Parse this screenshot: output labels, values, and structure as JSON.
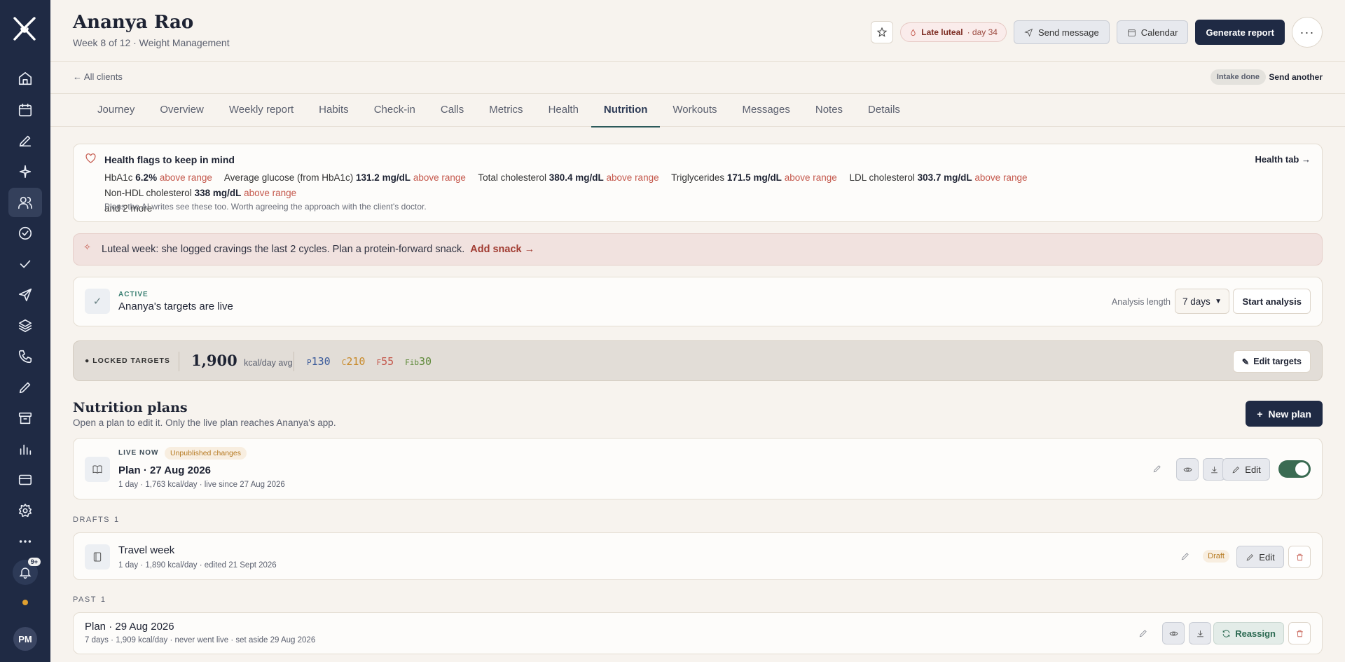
{
  "client": {
    "name": "Ananya Rao",
    "subtitle": "Week 8 of 12 · Weight Management"
  },
  "header": {
    "phase_label": "Late luteal",
    "phase_day": "· day 34",
    "send_message": "Send message",
    "calendar": "Calendar",
    "generate_report": "Generate report",
    "more": "···"
  },
  "breadcrumb": {
    "back": "All clients",
    "intake": "Intake done",
    "send_another": "Send another"
  },
  "tabs": [
    "Journey",
    "Overview",
    "Weekly report",
    "Habits",
    "Check-in",
    "Calls",
    "Metrics",
    "Health",
    "Nutrition",
    "Workouts",
    "Messages",
    "Notes",
    "Details"
  ],
  "active_tab": "Nutrition",
  "health_flags": {
    "title": "Health flags to keep in mind",
    "link": "Health tab →",
    "above_label": "above range",
    "items": [
      {
        "name": "HbA1c",
        "value": "6.2%"
      },
      {
        "name": "Average glucose (from HbA1c)",
        "value": "131.2 mg/dL"
      },
      {
        "name": "Total cholesterol",
        "value": "380.4 mg/dL"
      },
      {
        "name": "Triglycerides",
        "value": "171.5 mg/dL"
      },
      {
        "name": "LDL cholesterol",
        "value": "303.7 mg/dL"
      },
      {
        "name": "Non-HDL cholesterol",
        "value": "338 mg/dL"
      }
    ],
    "more": "and 2 more",
    "note": "Plans the AI writes see these too. Worth agreeing the approach with the client's doctor."
  },
  "luteal_tip": {
    "text": "Luteal week: she logged cravings the last 2 cycles. Plan a protein-forward snack.",
    "action": "Add snack →"
  },
  "active": {
    "label": "ACTIVE",
    "title": "Ananya's targets are live",
    "analysis_label": "Analysis length",
    "analysis_value": "7 days",
    "start": "Start analysis"
  },
  "locked": {
    "label": "LOCKED TARGETS",
    "kcal": "1,900",
    "kcal_unit": "kcal/day avg",
    "macros": [
      {
        "key": "P",
        "value": "130"
      },
      {
        "key": "C",
        "value": "210"
      },
      {
        "key": "F",
        "value": "55"
      },
      {
        "key": "Fib",
        "value": "30"
      }
    ],
    "edit": "Edit targets"
  },
  "plans": {
    "title": "Nutrition plans",
    "subtitle": "Open a plan to edit it. Only the live plan reaches Ananya's app.",
    "new_plan": "New plan",
    "live": {
      "label": "LIVE NOW",
      "badge": "Unpublished changes",
      "title": "Plan · 27 Aug 2026",
      "meta": "1 day · 1,763 kcal/day · live since 27 Aug 2026",
      "edit": "Edit",
      "toggle_on": true
    },
    "drafts_label": "DRAFTS",
    "drafts_count": "1",
    "draft": {
      "title": "Travel week",
      "meta": "1 day · 1,890 kcal/day · edited 21 Sept 2026",
      "badge": "Draft",
      "edit": "Edit"
    },
    "past_label": "PAST",
    "past_count": "1",
    "past": {
      "title": "Plan · 29 Aug 2026",
      "meta": "7 days · 1,909 kcal/day · never went live · set aside 29 Aug 2026",
      "reassign": "Reassign"
    }
  },
  "sidebar": {
    "notif_count": "9+",
    "avatar": "PM"
  }
}
